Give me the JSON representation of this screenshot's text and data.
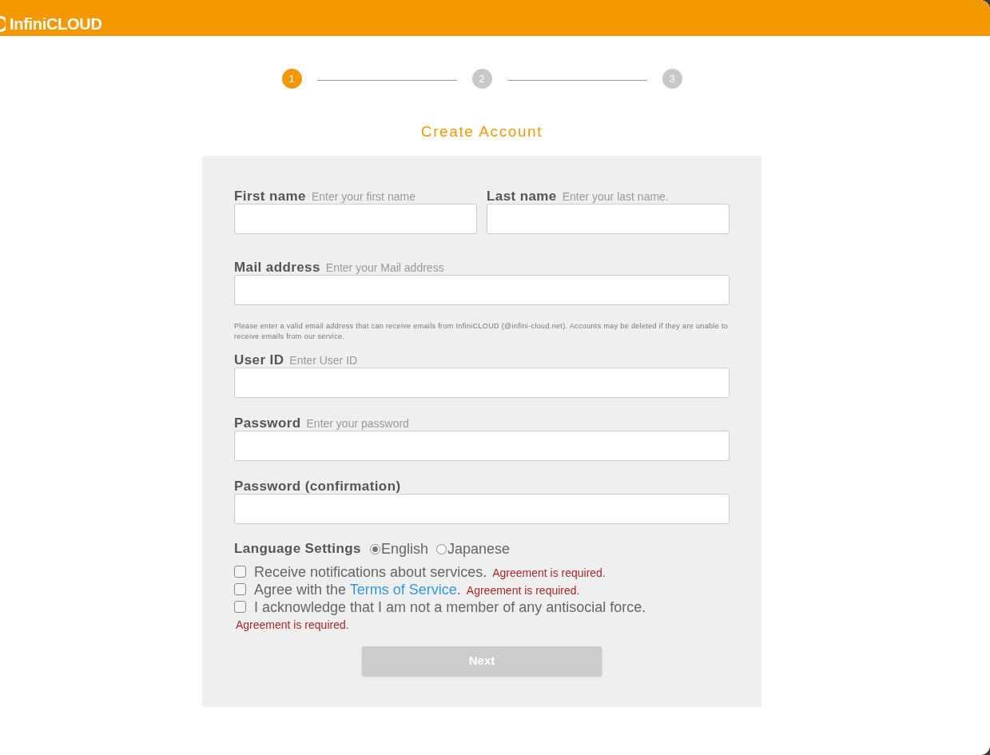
{
  "header": {
    "logo_text": "InfiniCLOUD"
  },
  "steps": [
    {
      "label": "1",
      "selected": true
    },
    {
      "label": "2",
      "selected": false
    },
    {
      "label": "3",
      "selected": false
    }
  ],
  "title": "Create Account",
  "form": {
    "rows": [
      {
        "fields": [
          {
            "label": "First name",
            "hint": "Enter your first name"
          },
          {
            "label": "Last name",
            "hint": "Enter your last name."
          }
        ]
      },
      {
        "fields": [
          {
            "label": "Mail address",
            "hint": "Enter your Mail address",
            "note": "Please enter a valid email address that can receive emails from InfiniCLOUD (@infini-cloud.net). Accounts may be deleted if they are unable to receive emails from our service."
          }
        ]
      },
      {
        "fields": [
          {
            "label": "User ID",
            "hint": "Enter User ID"
          }
        ]
      },
      {
        "fields": [
          {
            "label": "Password",
            "hint": "Enter your password"
          }
        ]
      },
      {
        "fields": [
          {
            "label": "Password (confirmation)"
          }
        ]
      }
    ],
    "language": {
      "label": "Language Settings",
      "options": [
        {
          "label": "English",
          "selected": true
        },
        {
          "label": "Japanese",
          "selected": false
        }
      ]
    },
    "agreements": [
      {
        "text": "Receive notifications about services.",
        "checked": false,
        "error": "Agreement is required."
      },
      {
        "text": "Agree with the ",
        "link": "Terms of Service",
        "text_after": ".",
        "checked": false,
        "error": "Agreement is required."
      },
      {
        "text": "I acknowledge that I am not a member of any antisocial force.",
        "checked": false,
        "error": "Agreement is required."
      }
    ],
    "next_button": {
      "label": "Next",
      "disabled": true
    }
  }
}
